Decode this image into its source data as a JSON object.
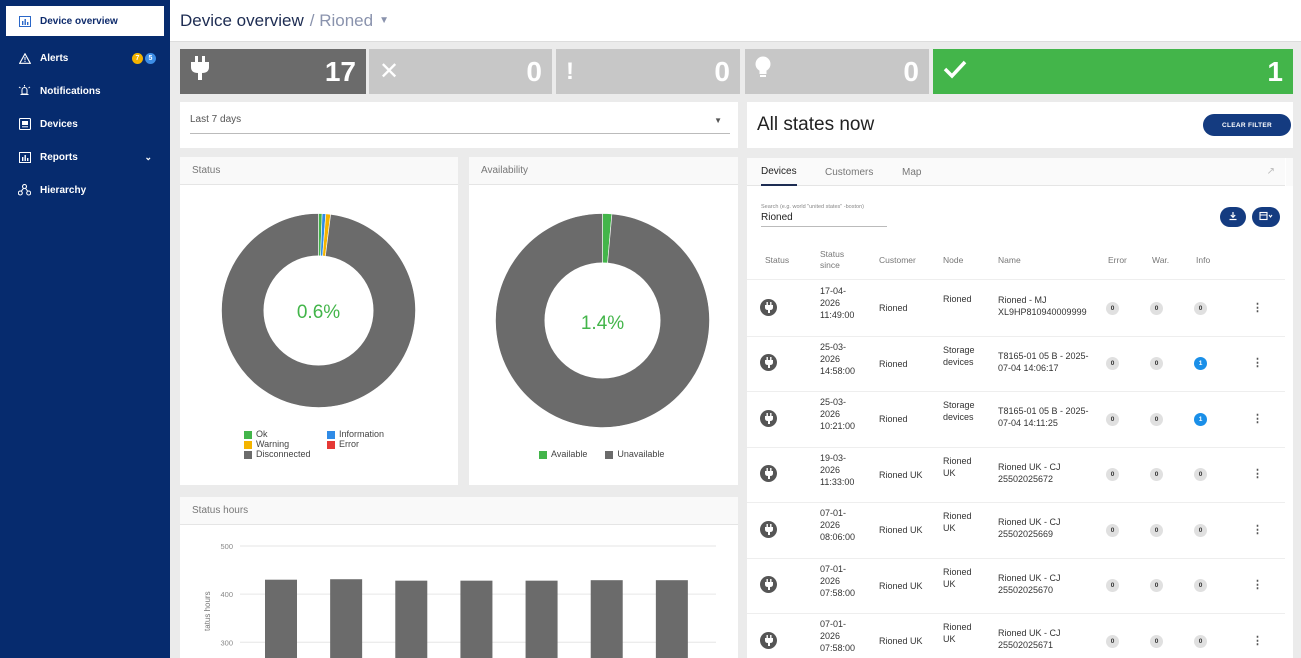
{
  "sidebar": {
    "items": [
      {
        "label": "Device overview",
        "icon": "bar-chart-icon"
      },
      {
        "label": "Alerts",
        "icon": "warning-icon",
        "badges": [
          "7",
          "5"
        ]
      },
      {
        "label": "Notifications",
        "icon": "bell-icon"
      },
      {
        "label": "Devices",
        "icon": "device-icon"
      },
      {
        "label": "Reports",
        "icon": "report-chart-icon"
      },
      {
        "label": "Hierarchy",
        "icon": "hierarchy-icon"
      }
    ]
  },
  "header": {
    "title": "Device overview",
    "breadcrumb": "/ Rioned"
  },
  "counters": [
    {
      "value": "17",
      "icon": "plug-icon",
      "color": "#6b6b6b"
    },
    {
      "value": "0",
      "icon": "x-icon",
      "color": "#c7c7c7"
    },
    {
      "value": "0",
      "icon": "exclamation-icon",
      "color": "#c7c7c7"
    },
    {
      "value": "0",
      "icon": "bulb-icon",
      "color": "#c7c7c7"
    },
    {
      "value": "1",
      "icon": "check-icon",
      "color": "#43b54a"
    }
  ],
  "filter": {
    "period": "Last 7 days"
  },
  "status_panel": {
    "title": "Status",
    "center": "0.6%",
    "legend": [
      "Ok",
      "Information",
      "Warning",
      "Error",
      "Disconnected"
    ],
    "colors": {
      "ok": "#43b54a",
      "info": "#2f8be6",
      "warning": "#f4b400",
      "error": "#e53935",
      "disconnected": "#6b6b6b"
    }
  },
  "availability_panel": {
    "title": "Availability",
    "center": "1.4%",
    "legend": [
      "Available",
      "Unavailable"
    ]
  },
  "status_hours": {
    "title": "Status hours",
    "ylabel": "tatus hours",
    "ticks": [
      "500",
      "400",
      "300"
    ]
  },
  "chart_data": [
    {
      "type": "pie",
      "title": "Status",
      "labels": [
        "Ok",
        "Information",
        "Warning",
        "Disconnected"
      ],
      "values": [
        0.6,
        0.6,
        0.8,
        98.0
      ]
    },
    {
      "type": "pie",
      "title": "Availability",
      "labels": [
        "Available",
        "Unavailable"
      ],
      "values": [
        1.4,
        98.6
      ]
    },
    {
      "type": "bar",
      "title": "Status hours",
      "ylabel": "tatus hours",
      "values": [
        430,
        431,
        428,
        428,
        428,
        429,
        429
      ],
      "ylim": [
        230,
        500
      ]
    }
  ],
  "right": {
    "title": "All states now",
    "clear_filter": "CLEAR FILTER",
    "tabs": [
      "Devices",
      "Customers",
      "Map"
    ],
    "search_label": "Search (e.g. world \"united states\" -boston)",
    "search_value": "Rioned",
    "columns": [
      "Status",
      "Status since",
      "Customer",
      "Node",
      "Name",
      "Error",
      "War.",
      "Info"
    ],
    "rows": [
      {
        "since": [
          "17-04-",
          "2026",
          "11:49:00"
        ],
        "customer": "Rioned",
        "node": [
          "Rioned"
        ],
        "name": [
          "Rioned - MJ",
          "XL9HP810940009999"
        ],
        "error": "0",
        "warn": "0",
        "info": "0"
      },
      {
        "since": [
          "25-03-",
          "2026",
          "14:58:00"
        ],
        "customer": "Rioned",
        "node": [
          "Storage",
          "devices"
        ],
        "name": [
          "T8165-01 05 B - 2025-",
          "07-04 14:06:17"
        ],
        "error": "0",
        "warn": "0",
        "info": "1"
      },
      {
        "since": [
          "25-03-",
          "2026",
          "10:21:00"
        ],
        "customer": "Rioned",
        "node": [
          "Storage",
          "devices"
        ],
        "name": [
          "T8165-01 05 B - 2025-",
          "07-04 14:11:25"
        ],
        "error": "0",
        "warn": "0",
        "info": "1"
      },
      {
        "since": [
          "19-03-",
          "2026",
          "11:33:00"
        ],
        "customer": "Rioned UK",
        "node": [
          "Rioned",
          "UK"
        ],
        "name": [
          "Rioned UK - CJ",
          "25502025672"
        ],
        "error": "0",
        "warn": "0",
        "info": "0"
      },
      {
        "since": [
          "07-01-",
          "2026",
          "08:06:00"
        ],
        "customer": "Rioned UK",
        "node": [
          "Rioned",
          "UK"
        ],
        "name": [
          "Rioned UK - CJ",
          "25502025669"
        ],
        "error": "0",
        "warn": "0",
        "info": "0"
      },
      {
        "since": [
          "07-01-",
          "2026",
          "07:58:00"
        ],
        "customer": "Rioned UK",
        "node": [
          "Rioned",
          "UK"
        ],
        "name": [
          "Rioned UK - CJ",
          "25502025670"
        ],
        "error": "0",
        "warn": "0",
        "info": "0"
      },
      {
        "since": [
          "07-01-",
          "2026",
          "07:58:00"
        ],
        "customer": "Rioned UK",
        "node": [
          "Rioned",
          "UK"
        ],
        "name": [
          "Rioned UK - CJ",
          "25502025671"
        ],
        "error": "0",
        "warn": "0",
        "info": "0"
      }
    ]
  }
}
